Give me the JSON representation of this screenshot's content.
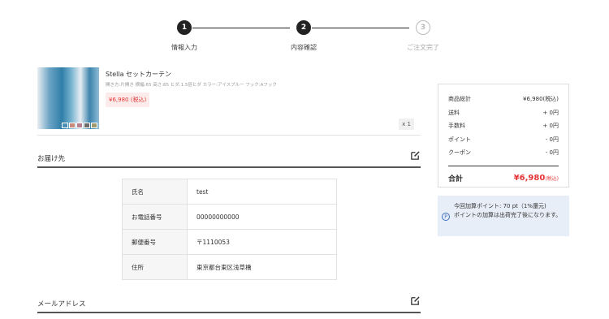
{
  "stepper": {
    "steps": [
      {
        "number": "1",
        "label": "情報入力",
        "state": "done"
      },
      {
        "number": "2",
        "label": "内容確認",
        "state": "current"
      },
      {
        "number": "3",
        "label": "ご注文完了",
        "state": "pending"
      }
    ]
  },
  "product": {
    "name": "Stella セットカーテン",
    "spec": "開き方:片開き 横幅:65 高さ:65 ヒダ:1.5倍ヒダ カラー:アイスブルー フック:Aフック",
    "price": "¥6,980 (税込)",
    "quantity": "x 1",
    "swatch_colors": [
      "#4d90b6",
      "#c98a7e",
      "#b87f8e",
      "#6c6c6c",
      "#a0986f"
    ]
  },
  "delivery": {
    "title": "お届け先",
    "rows": [
      {
        "label": "氏名",
        "value": "test"
      },
      {
        "label": "お電話番号",
        "value": "00000000000"
      },
      {
        "label": "郵便番号",
        "value": "〒1110053"
      },
      {
        "label": "住所",
        "value": "東京都台東区浅草橋"
      }
    ]
  },
  "email": {
    "title": "メールアドレス"
  },
  "summary": {
    "rows": [
      {
        "label": "商品総計",
        "value": "¥6,980(税込)"
      },
      {
        "label": "送料",
        "value": "+ 0円"
      },
      {
        "label": "手数料",
        "value": "+ 0円"
      },
      {
        "label": "ポイント",
        "value": "- 0円"
      },
      {
        "label": "クーポン",
        "value": "- 0円"
      }
    ],
    "total_label": "合計",
    "total_value": "¥6,980",
    "total_suffix": "(税込)"
  },
  "points": {
    "line1": "今回加算ポイント: 70 pt（1%還元)",
    "line2": "ポイントの加算は出荷完了後になります。",
    "icon": "P"
  },
  "colors": {
    "accent_red": "#e23636",
    "points_bg": "#e8eef8"
  }
}
